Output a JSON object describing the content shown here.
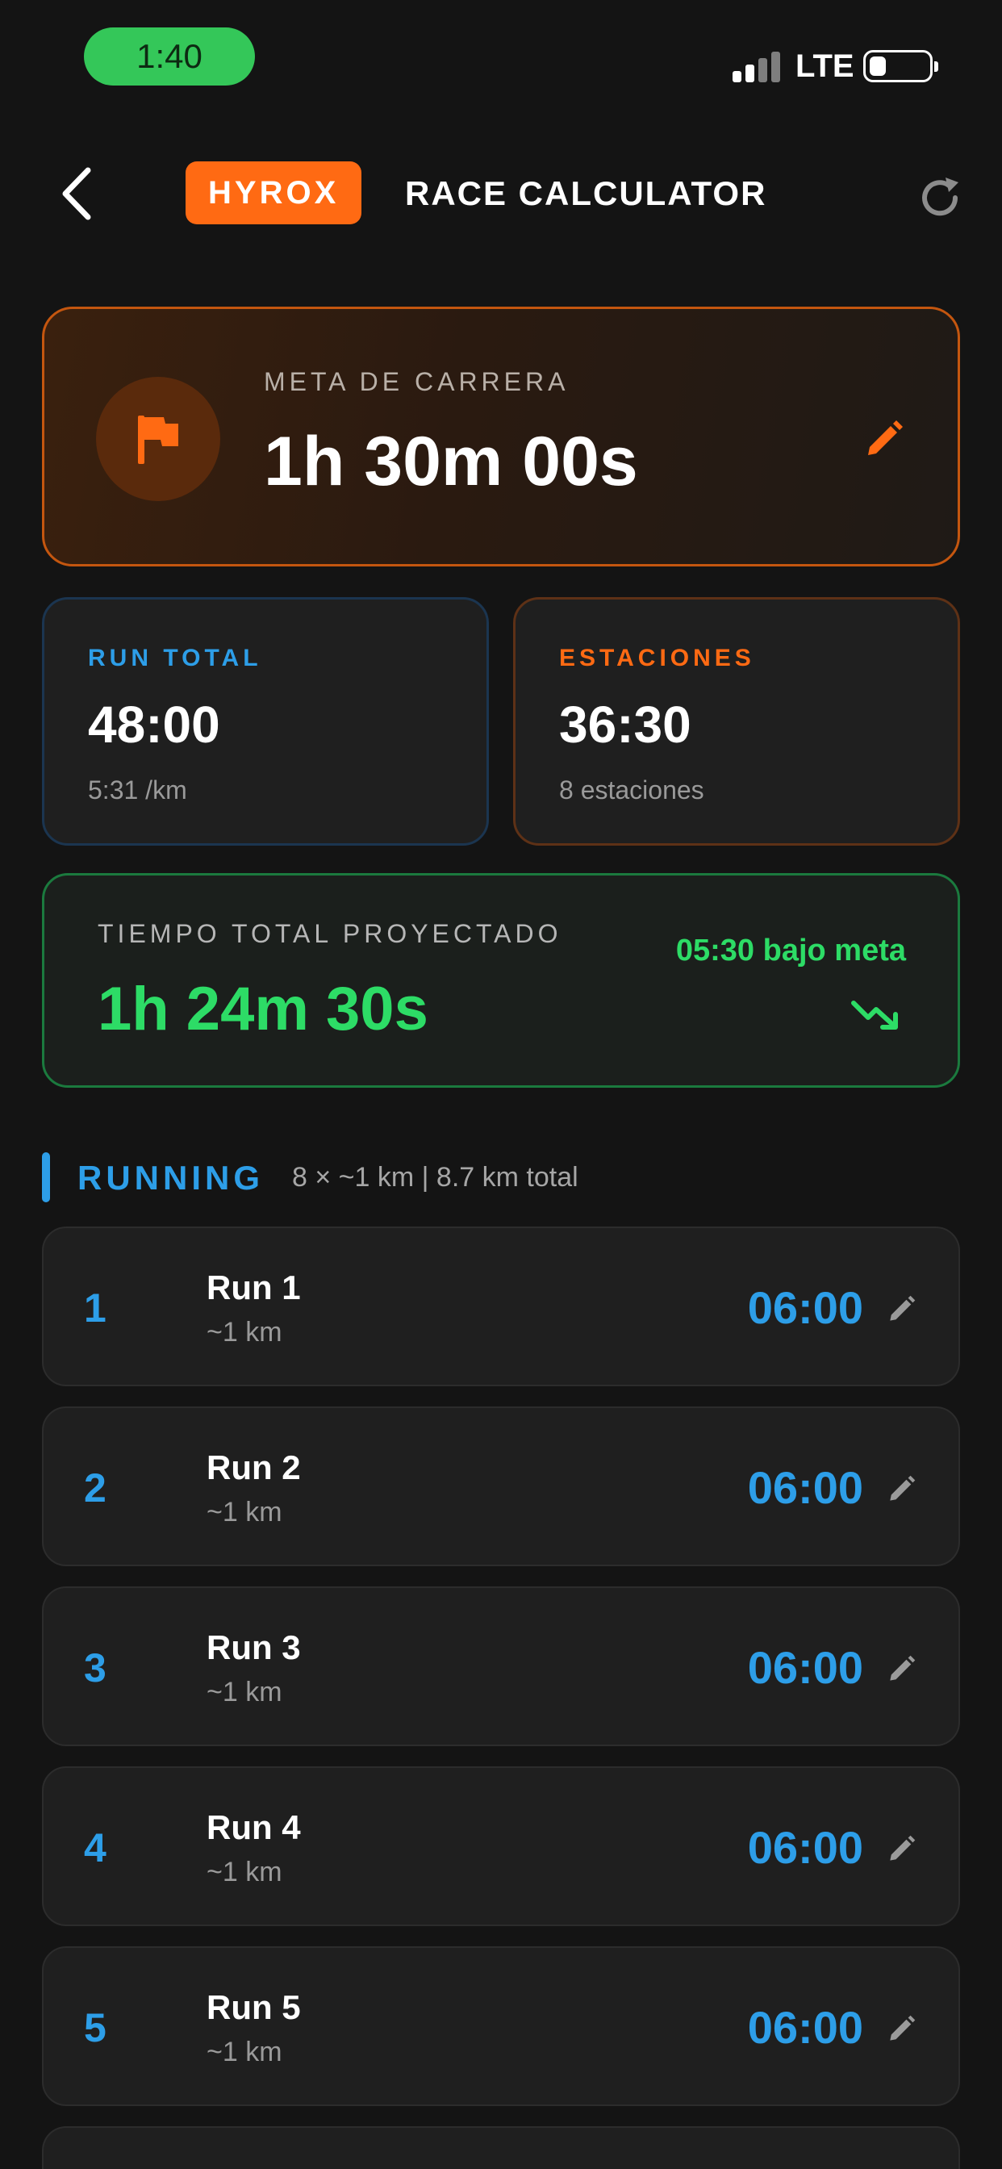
{
  "status_bar": {
    "time": "1:40",
    "network": "LTE"
  },
  "header": {
    "brand": "HYROX",
    "title": "RACE CALCULATOR"
  },
  "goal": {
    "label": "META DE CARRERA",
    "value": "1h 30m 00s"
  },
  "run_total": {
    "label": "RUN TOTAL",
    "value": "48:00",
    "sub": "5:31 /km"
  },
  "stations": {
    "label": "ESTACIONES",
    "value": "36:30",
    "sub": "8 estaciones"
  },
  "projected": {
    "label": "TIEMPO TOTAL PROYECTADO",
    "value": "1h 24m 30s",
    "diff": "05:30 bajo meta"
  },
  "running_section": {
    "title": "RUNNING",
    "meta": "8 × ~1 km  |  8.7 km total"
  },
  "runs": [
    {
      "index": "1",
      "name": "Run 1",
      "distance": "~1 km",
      "time": "06:00"
    },
    {
      "index": "2",
      "name": "Run 2",
      "distance": "~1 km",
      "time": "06:00"
    },
    {
      "index": "3",
      "name": "Run 3",
      "distance": "~1 km",
      "time": "06:00"
    },
    {
      "index": "4",
      "name": "Run 4",
      "distance": "~1 km",
      "time": "06:00"
    },
    {
      "index": "5",
      "name": "Run 5",
      "distance": "~1 km",
      "time": "06:00"
    }
  ],
  "colors": {
    "accent_orange": "#ff6a13",
    "run_blue": "#2d9ee8",
    "success_green": "#2ddc66",
    "background": "#141414"
  },
  "icons": {
    "back": "chevron-left-icon",
    "refresh": "refresh-icon",
    "goal": "flag-icon",
    "edit": "pencil-icon",
    "trend": "trending-down-icon"
  }
}
